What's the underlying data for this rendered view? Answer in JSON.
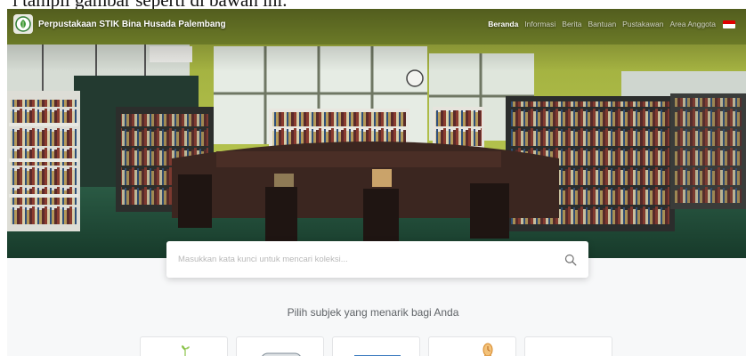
{
  "caption": {
    "text": "i tampil gambar seperti di bawah ini."
  },
  "site": {
    "title": "Perpustakaan STIK Bina Husada Palembang",
    "logo_icon": "leaf-emblem-icon"
  },
  "nav": {
    "items": [
      {
        "label": "Beranda",
        "active": true
      },
      {
        "label": "Informasi",
        "active": false
      },
      {
        "label": "Berita",
        "active": false
      },
      {
        "label": "Bantuan",
        "active": false
      },
      {
        "label": "Pustakawan",
        "active": false
      },
      {
        "label": "Area Anggota",
        "active": false
      }
    ],
    "language_flag": "indonesia-flag-icon"
  },
  "hero": {
    "image": "library-panorama"
  },
  "search": {
    "placeholder": "Masukkan kata kunci untuk mencari koleksi...",
    "value": "",
    "icon": "search-icon"
  },
  "subjects": {
    "heading": "Pilih subjek yang menarik bagi Anda",
    "cards": [
      {
        "icon": "plant-icon"
      },
      {
        "icon": "scroll-icon"
      },
      {
        "icon": "whiteboard-icon"
      },
      {
        "icon": "clock-icon"
      },
      {
        "icon": "blank-icon"
      }
    ]
  },
  "colors": {
    "accent_green": "#2e7d32",
    "wall_green": "#b7c94a",
    "floor_green": "#1f4a37",
    "section_bg": "#f7f8f9",
    "heading_text": "#5f6367"
  }
}
